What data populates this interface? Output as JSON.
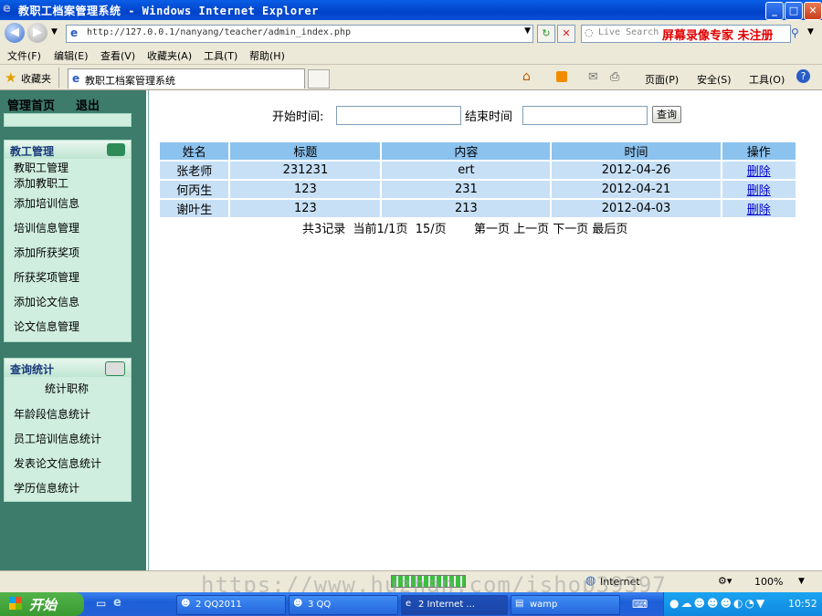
{
  "window": {
    "title": "教职工档案管理系统 - Windows Internet Explorer"
  },
  "address": {
    "url": "http://127.0.0.1/nanyang/teacher/admin_index.php"
  },
  "search": {
    "placeholder": "Live Search",
    "overlay_text": "屏幕录像专家 未注册"
  },
  "menubar": [
    "文件(F)",
    "编辑(E)",
    "查看(V)",
    "收藏夹(A)",
    "工具(T)",
    "帮助(H)"
  ],
  "favbar": {
    "favorites_label": "收藏夹",
    "tab_title": "教职工档案管理系统",
    "page_menu": "页面(P)",
    "safety_menu": "安全(S)",
    "tools_menu": "工具(O)"
  },
  "sidebar": {
    "home": "管理首页",
    "logout": "退出",
    "staff_section": {
      "title": "教工管理",
      "items": [
        "教职工管理",
        "添加教职工",
        "添加培训信息",
        "培训信息管理",
        "添加所获奖项",
        "所获奖项管理",
        "添加论文信息",
        "论文信息管理"
      ]
    },
    "stats_section": {
      "title": "查询统计",
      "items": [
        "统计职称",
        "年龄段信息统计",
        "员工培训信息统计",
        "发表论文信息统计",
        "学历信息统计"
      ]
    }
  },
  "filter": {
    "start_label": "开始时间:",
    "end_label": "结束时间",
    "start_value": "",
    "end_value": "",
    "query_button": "查询"
  },
  "table": {
    "headers": [
      "姓名",
      "标题",
      "内容",
      "时间",
      "操作"
    ],
    "rows": [
      [
        "张老师",
        "231231",
        "ert",
        "2012-04-26",
        "删除"
      ],
      [
        "何丙生",
        "123",
        "231",
        "2012-04-21",
        "删除"
      ],
      [
        "谢叶生",
        "123",
        "213",
        "2012-04-03",
        "删除"
      ]
    ]
  },
  "pager": {
    "summary": "共3记录  当前1/1页  15/页",
    "first": "第一页",
    "prev": "上一页",
    "next": "下一页",
    "last": "最后页"
  },
  "statusbar": {
    "zone": "Internet",
    "zoom": "100%",
    "watermark": "https://www.huzhan.com/ishop39397"
  },
  "taskbar": {
    "start": "开始",
    "tasks": [
      "2 QQ2011",
      "3 QQ",
      "2 Internet ...",
      "wamp"
    ],
    "clock": "10:52"
  }
}
